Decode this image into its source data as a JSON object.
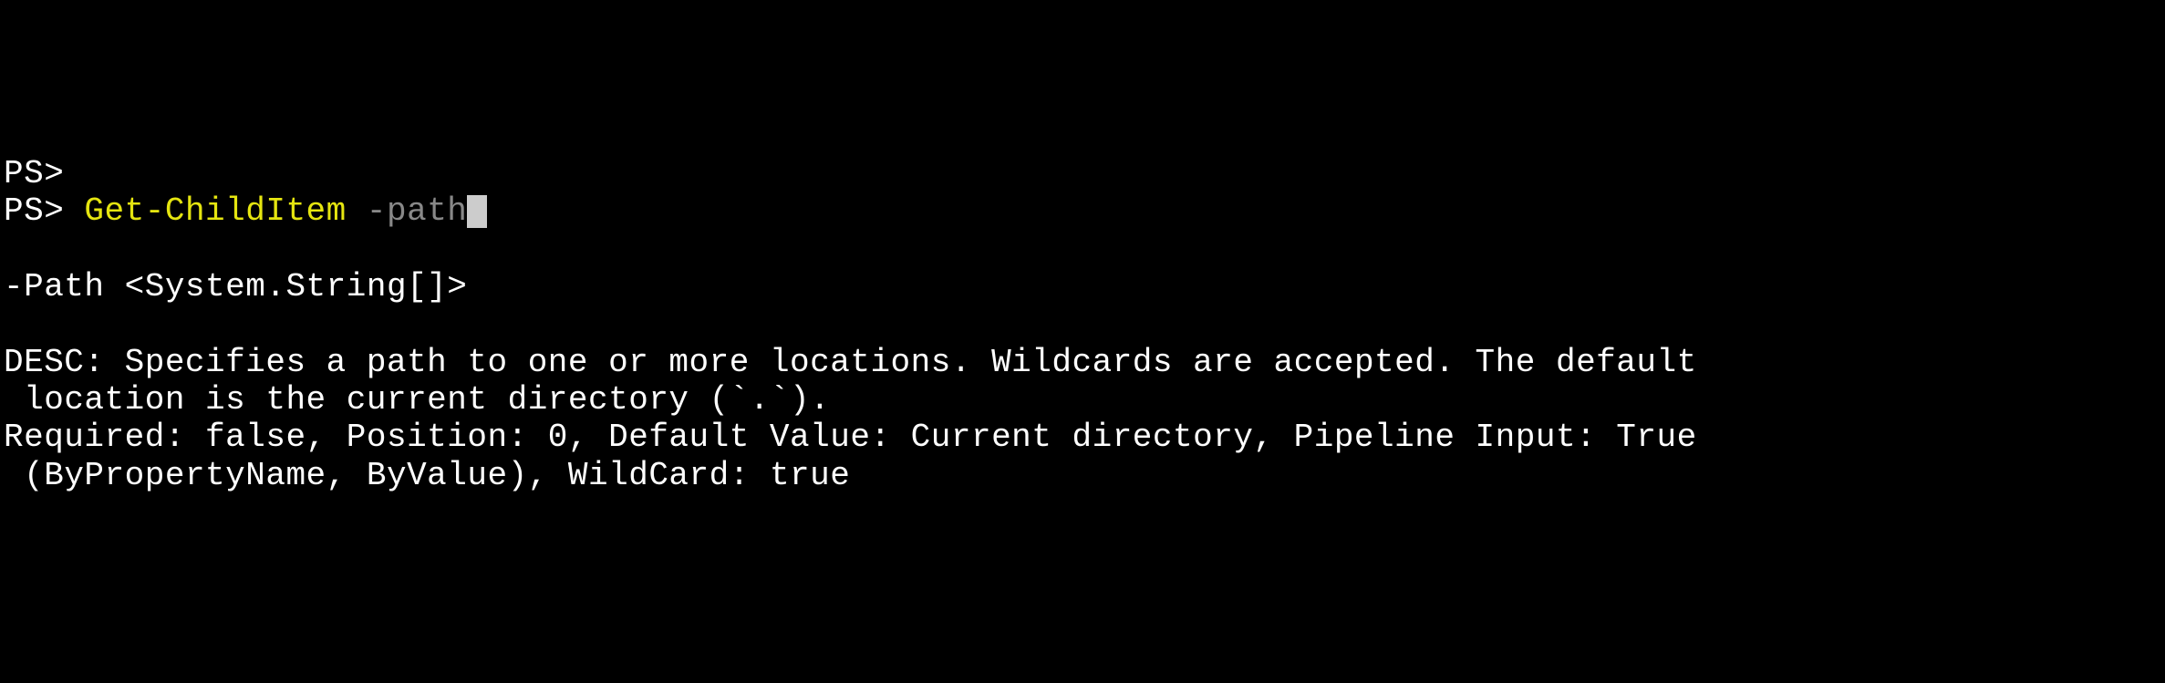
{
  "terminal": {
    "line1": {
      "prompt": "PS>"
    },
    "line2": {
      "prompt": "PS> ",
      "cmdlet": "Get-ChildItem",
      "space": " ",
      "param": "-path"
    },
    "syntax": "-Path <System.String[]>",
    "desc_label": "DESC: ",
    "desc_text": "Specifies a path to one or more locations. Wildcards are accepted. The default",
    "desc_cont": " location is the current directory (`.`).",
    "attrs_line": "Required: false, Position: 0, Default Value: Current directory, Pipeline Input: True",
    "attrs_cont": " (ByPropertyName, ByValue), WildCard: true"
  }
}
